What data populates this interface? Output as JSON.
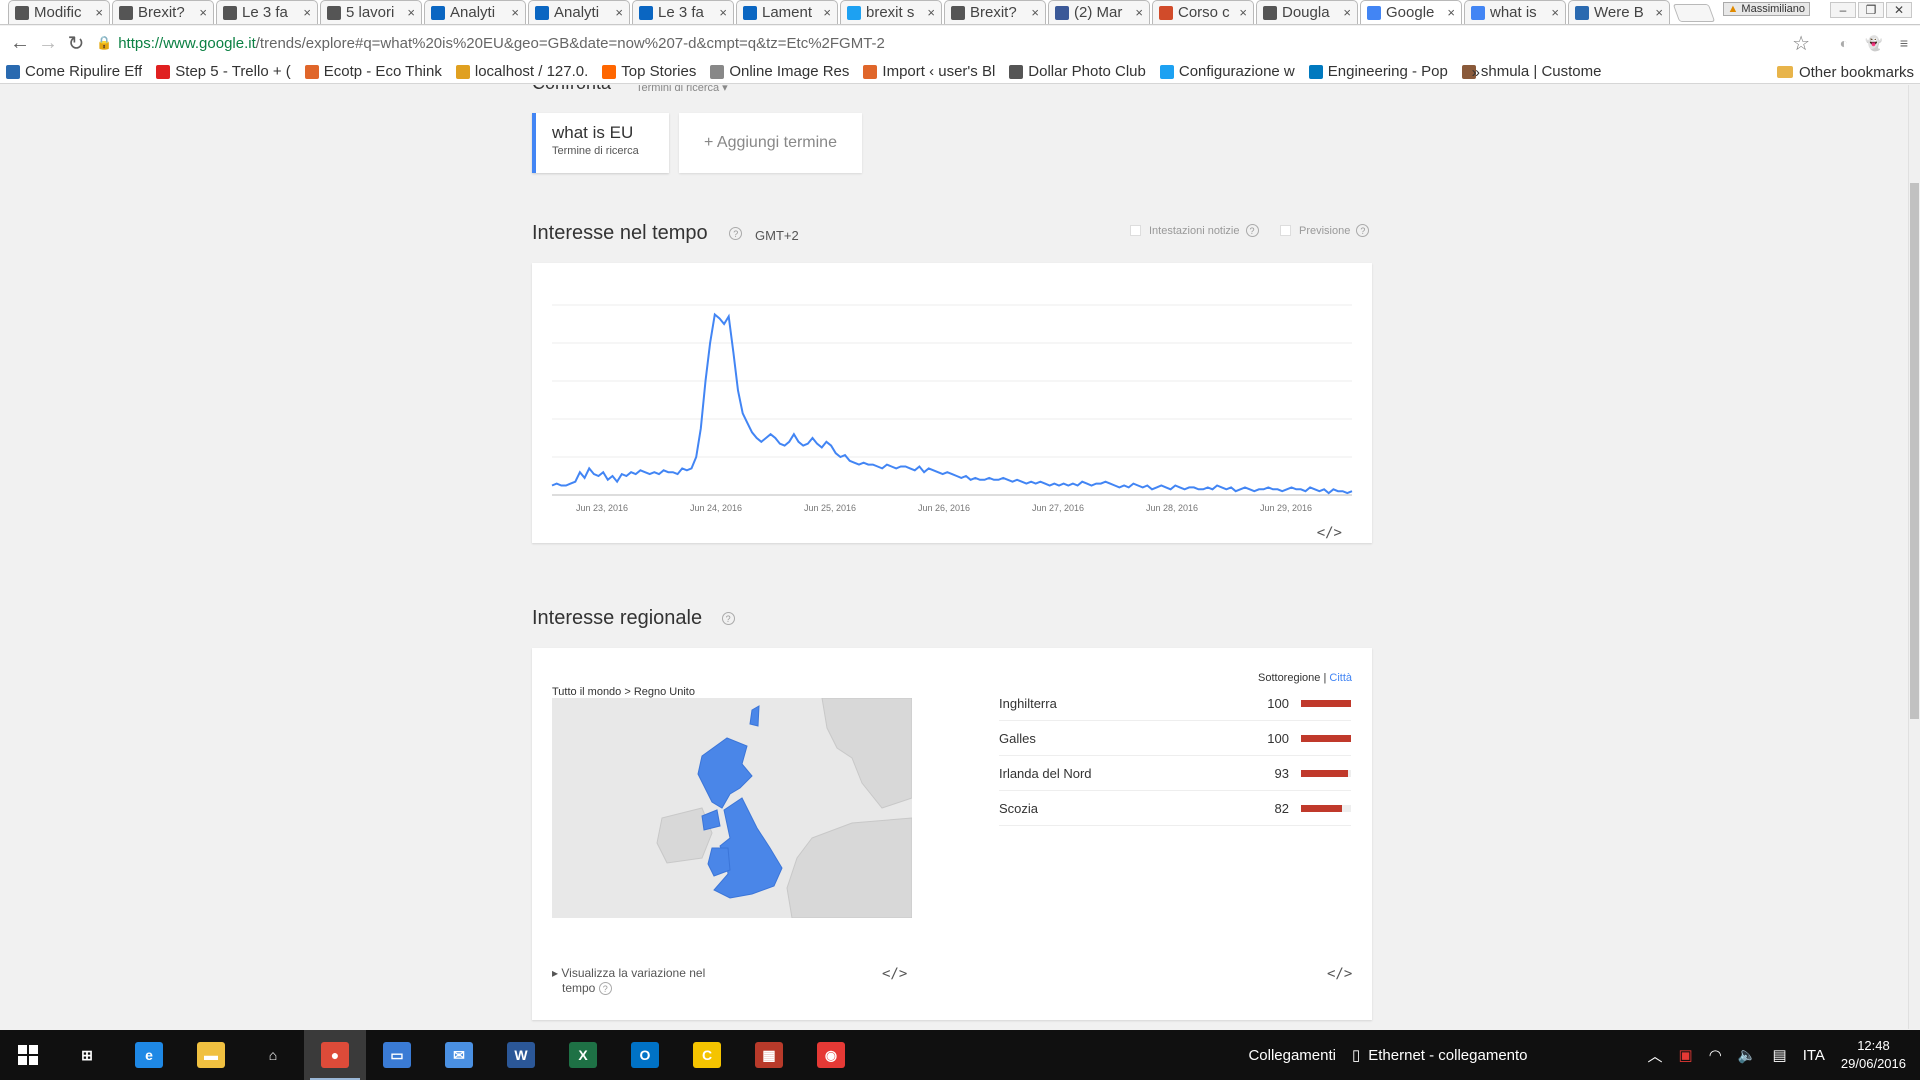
{
  "tabs": [
    {
      "title": "Modific",
      "icon": "lightbulb-icon",
      "color": "#555555"
    },
    {
      "title": "Brexit?",
      "icon": "lightbulb-icon",
      "color": "#555555"
    },
    {
      "title": "Le 3 fa",
      "icon": "lightbulb-icon",
      "color": "#555555"
    },
    {
      "title": "5 lavori",
      "icon": "lightbulb-icon",
      "color": "#555555"
    },
    {
      "title": "Analyti",
      "icon": "linkedin-icon",
      "color": "#0a66c2"
    },
    {
      "title": "Analyti",
      "icon": "linkedin-icon",
      "color": "#0a66c2"
    },
    {
      "title": "Le 3 fa",
      "icon": "linkedin-icon",
      "color": "#0a66c2"
    },
    {
      "title": "Lament",
      "icon": "linkedin-icon",
      "color": "#0a66c2"
    },
    {
      "title": "brexit s",
      "icon": "twitter-icon",
      "color": "#1da1f2"
    },
    {
      "title": "Brexit?",
      "icon": "lightbulb-icon",
      "color": "#555555"
    },
    {
      "title": "(2) Mar",
      "icon": "facebook-icon",
      "color": "#3b5998"
    },
    {
      "title": "Corso c",
      "icon": "course-icon",
      "color": "#d14b2a"
    },
    {
      "title": "Dougla",
      "icon": "audio-icon",
      "color": "#555555"
    },
    {
      "title": "Google",
      "icon": "google-icon",
      "color": "#4285f4",
      "active": true
    },
    {
      "title": "what is",
      "icon": "google-icon",
      "color": "#4285f4"
    },
    {
      "title": "Were B",
      "icon": "site-icon",
      "color": "#2a6ab0"
    }
  ],
  "tab_close": "×",
  "user_badge": "Massimiliano",
  "window_controls": {
    "minimize": "‒",
    "restore": "❐",
    "close": "✕"
  },
  "address": {
    "protocol_host": "https://www.google.it",
    "path": "/trends/explore#q=what%20is%20EU&geo=GB&date=now%207-d&cmpt=q&tz=Etc%2FGMT-2"
  },
  "bookmarks": [
    {
      "label": "Come Ripulire Eff",
      "icon": "wp-icon",
      "color": "#2a6ab0"
    },
    {
      "label": "Step 5 - Trello + (",
      "icon": "youtube-icon",
      "color": "#e02020"
    },
    {
      "label": "Ecotp - Eco Think",
      "icon": "ecotp-icon",
      "color": "#e0662a"
    },
    {
      "label": "localhost / 127.0.",
      "icon": "pma-icon",
      "color": "#e0a020"
    },
    {
      "label": "Top Stories",
      "icon": "hn-icon",
      "color": "#ff6600"
    },
    {
      "label": "Online Image Res",
      "icon": "page-icon",
      "color": "#888888"
    },
    {
      "label": "Import ‹ user's Bl",
      "icon": "import-icon",
      "color": "#e0662a"
    },
    {
      "label": "Dollar Photo Club",
      "icon": "star-icon",
      "color": "#555555"
    },
    {
      "label": "Configurazione w",
      "icon": "twitter-icon",
      "color": "#1da1f2"
    },
    {
      "label": "Engineering - Pop",
      "icon": "trello-icon",
      "color": "#0079bf"
    },
    {
      "label": "shmula | Custome",
      "icon": "avatar-icon",
      "color": "#8a5a3a"
    }
  ],
  "bookmarks_more": "»",
  "other_bookmarks": "Other bookmarks",
  "compare": {
    "label": "Confronta",
    "sub": "Termini di ricerca ▾"
  },
  "term": {
    "name": "what is EU",
    "sub": "Termine di ricerca"
  },
  "add_term": "+ Aggiungi termine",
  "interest_time": {
    "title": "Interesse nel tempo",
    "help": "?",
    "timezone": "GMT+2",
    "news": "Intestazioni notizie",
    "forecast": "Previsione",
    "embed": "</>"
  },
  "chart_data": {
    "type": "line",
    "series": [
      {
        "color": "#4285f4",
        "values": [
          5,
          6,
          5,
          5,
          6,
          7,
          12,
          9,
          14,
          11,
          10,
          12,
          8,
          10,
          7,
          11,
          10,
          12,
          11,
          13,
          12,
          11,
          12,
          11,
          13,
          12,
          12,
          11,
          14,
          13,
          14,
          20,
          35,
          60,
          80,
          95,
          93,
          90,
          94,
          75,
          55,
          43,
          38,
          33,
          30,
          28,
          30,
          32,
          30,
          27,
          26,
          28,
          32,
          28,
          26,
          27,
          30,
          27,
          25,
          28,
          26,
          22,
          20,
          21,
          18,
          17,
          16,
          17,
          16,
          16,
          15,
          14,
          16,
          15,
          14,
          15,
          15,
          14,
          13,
          15,
          12,
          14,
          13,
          12,
          11,
          12,
          11,
          10,
          9,
          10,
          8,
          9,
          8,
          8,
          9,
          8,
          8,
          9,
          8,
          7,
          8,
          7,
          6,
          7,
          6,
          7,
          6,
          5,
          6,
          5,
          6,
          5,
          6,
          5,
          7,
          6,
          5,
          6,
          6,
          7,
          6,
          5,
          4,
          5,
          4,
          6,
          5,
          4,
          5,
          3,
          4,
          5,
          4,
          3,
          5,
          4,
          3,
          4,
          4,
          3,
          3,
          4,
          3,
          5,
          4,
          3,
          4,
          2,
          3,
          4,
          3,
          2,
          3,
          3,
          4,
          3,
          3,
          2,
          3,
          4,
          3,
          3,
          2,
          4,
          3,
          2,
          3,
          1,
          3,
          2,
          2,
          1,
          2
        ]
      }
    ],
    "x_ticks": [
      "Jun 23, 2016",
      "Jun 24, 2016",
      "Jun 25, 2016",
      "Jun 26, 2016",
      "Jun 27, 2016",
      "Jun 28, 2016",
      "Jun 29, 2016"
    ],
    "ylim": [
      0,
      100
    ],
    "grid": true
  },
  "interest_region": {
    "title": "Interesse regionale",
    "help": "?",
    "breadcrumb": "Tutto il mondo > Regno Unito",
    "subregion": "Sottoregione",
    "city": "Città",
    "regions": [
      {
        "name": "Inghilterra",
        "value": 100
      },
      {
        "name": "Galles",
        "value": 100
      },
      {
        "name": "Irlanda del Nord",
        "value": 93
      },
      {
        "name": "Scozia",
        "value": 82
      }
    ],
    "bar_color": "#c0392b",
    "variation": "Visualizza la variazione nel",
    "variation2": "tempo",
    "embed": "</>"
  },
  "taskbar": {
    "apps": [
      {
        "icon": "store-icon",
        "color": "#ffffff",
        "label": "⊞"
      },
      {
        "icon": "edge-icon",
        "color": "#1e88e5",
        "label": "e"
      },
      {
        "icon": "file-explorer-icon",
        "color": "#f0c040",
        "label": "▬"
      },
      {
        "icon": "home-icon",
        "color": "#ffffff",
        "label": "⌂"
      },
      {
        "icon": "chrome-icon",
        "color": "#dd4b39",
        "label": "●",
        "active": true
      },
      {
        "icon": "remote-desktop-icon",
        "color": "#3a7bd5",
        "label": "▭"
      },
      {
        "icon": "outlook-app-icon",
        "color": "#4a90e2",
        "label": "✉"
      },
      {
        "icon": "word-icon",
        "color": "#2b5797",
        "label": "W"
      },
      {
        "icon": "excel-icon",
        "color": "#1e7145",
        "label": "X"
      },
      {
        "icon": "outlook-icon",
        "color": "#0072c6",
        "label": "O"
      },
      {
        "icon": "camtasia-icon",
        "color": "#f5c400",
        "label": "C"
      },
      {
        "icon": "winrar-icon",
        "color": "#b83a2a",
        "label": "▦"
      },
      {
        "icon": "screenshot-icon",
        "color": "#e53935",
        "label": "◉"
      }
    ],
    "links_label": "Collegamenti",
    "network": "Ethernet - collegamento",
    "language": "ITA",
    "time": "12:48",
    "date": "29/06/2016"
  }
}
